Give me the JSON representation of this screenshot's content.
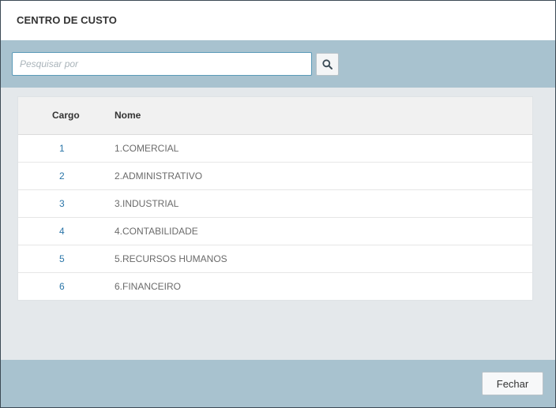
{
  "modal": {
    "title": "CENTRO DE CUSTO"
  },
  "search": {
    "placeholder": "Pesquisar por",
    "value": "",
    "button_icon": "search-icon"
  },
  "table": {
    "columns": [
      "Cargo",
      "Nome"
    ],
    "rows": [
      {
        "cargo": "1",
        "nome": "1.COMERCIAL"
      },
      {
        "cargo": "2",
        "nome": "2.ADMINISTRATIVO"
      },
      {
        "cargo": "3",
        "nome": "3.INDUSTRIAL"
      },
      {
        "cargo": "4",
        "nome": "4.CONTABILIDADE"
      },
      {
        "cargo": "5",
        "nome": "5.RECURSOS HUMANOS"
      },
      {
        "cargo": "6",
        "nome": "6.FINANCEIRO"
      }
    ]
  },
  "footer": {
    "close_label": "Fechar"
  },
  "colors": {
    "accent": "#2a75a8",
    "bar": "#a8c2cf",
    "body": "#e4e8eb"
  }
}
